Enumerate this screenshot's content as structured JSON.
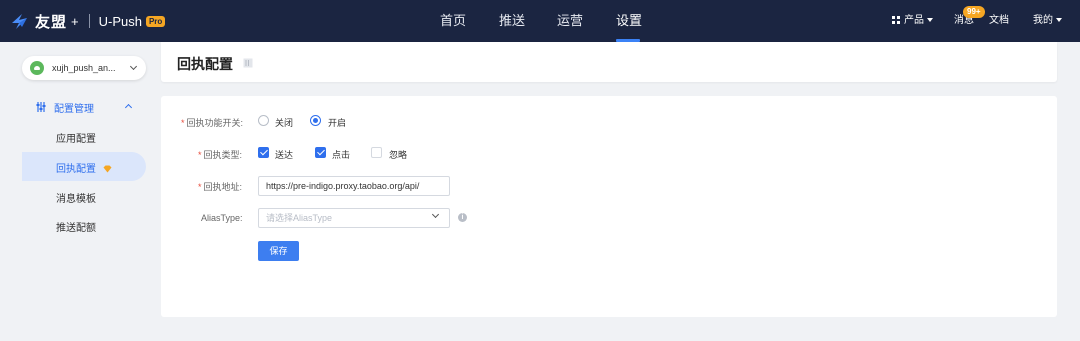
{
  "header": {
    "brand": "友盟",
    "plus": "+",
    "product": "U-Push",
    "pro_badge": "Pro",
    "nav": [
      {
        "label": "首页",
        "active": false
      },
      {
        "label": "推送",
        "active": false
      },
      {
        "label": "运营",
        "active": false
      },
      {
        "label": "设置",
        "active": true
      }
    ],
    "products_label": "产品",
    "messages_label": "消息",
    "messages_badge": "99+",
    "docs_label": "文档",
    "mine_label": "我的"
  },
  "sidebar": {
    "app_name": "xujh_push_an...",
    "group_label": "配置管理",
    "items": [
      {
        "label": "应用配置",
        "active": false
      },
      {
        "label": "回执配置",
        "active": true
      },
      {
        "label": "消息模板",
        "active": false
      },
      {
        "label": "推送配额",
        "active": false
      }
    ]
  },
  "page": {
    "title": "回执配置"
  },
  "form": {
    "switch_label": "回执功能开关:",
    "switch_options": [
      {
        "label": "关闭",
        "selected": false
      },
      {
        "label": "开启",
        "selected": true
      }
    ],
    "type_label": "回执类型:",
    "type_options": [
      {
        "label": "送达",
        "checked": true
      },
      {
        "label": "点击",
        "checked": true
      },
      {
        "label": "忽略",
        "checked": false
      }
    ],
    "url_label": "回执地址:",
    "url_value": "https://pre-indigo.proxy.taobao.org/api/",
    "alias_label": "AliasType:",
    "alias_placeholder": "请选择AliasType",
    "save_label": "保存"
  },
  "colors": {
    "topbar": "#1b2541",
    "accent": "#2f6fed",
    "badge": "#f5a623",
    "required": "#e74c3c"
  }
}
